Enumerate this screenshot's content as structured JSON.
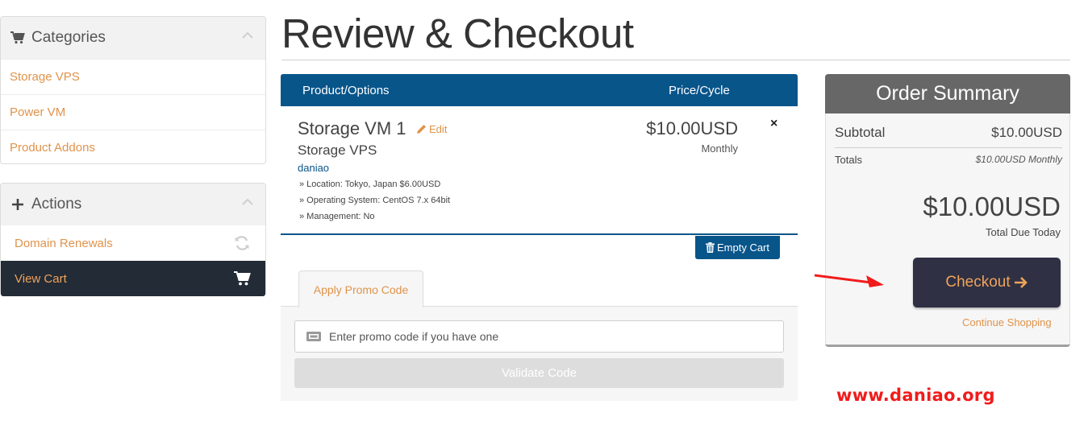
{
  "sidebar": {
    "categories": {
      "title": "Categories",
      "items": [
        {
          "label": "Storage VPS"
        },
        {
          "label": "Power VM"
        },
        {
          "label": "Product Addons"
        }
      ]
    },
    "actions": {
      "title": "Actions",
      "items": [
        {
          "label": "Domain Renewals",
          "icon": "refresh-icon"
        },
        {
          "label": "View Cart",
          "icon": "cart-icon",
          "active": true
        }
      ]
    }
  },
  "page": {
    "title": "Review & Checkout"
  },
  "cart": {
    "headers": {
      "product": "Product/Options",
      "price": "Price/Cycle"
    },
    "item": {
      "name": "Storage VM 1",
      "edit_label": "Edit",
      "group": "Storage VPS",
      "domain": "daniao",
      "options": [
        "» Location: Tokyo, Japan $6.00USD",
        "» Operating System: CentOS 7.x 64bit",
        "» Management: No"
      ],
      "price": "$10.00USD",
      "cycle": "Monthly",
      "remove_label": "×"
    },
    "empty_cart_label": "Empty Cart"
  },
  "promo": {
    "tab_label": "Apply Promo Code",
    "placeholder": "Enter promo code if you have one",
    "validate_label": "Validate Code"
  },
  "summary": {
    "title": "Order Summary",
    "subtotal_label": "Subtotal",
    "subtotal_value": "$10.00USD",
    "totals_label": "Totals",
    "totals_value": "$10.00USD Monthly",
    "total_due": "$10.00USD",
    "total_due_label": "Total Due Today",
    "checkout_label": "Checkout",
    "continue_label": "Continue Shopping"
  },
  "watermark": "www.daniao.org",
  "colors": {
    "primary_blue": "#08558a",
    "accent_orange": "#e0934b",
    "checkout_bg": "#2f3043",
    "annotation_red": "#f11b1b"
  }
}
